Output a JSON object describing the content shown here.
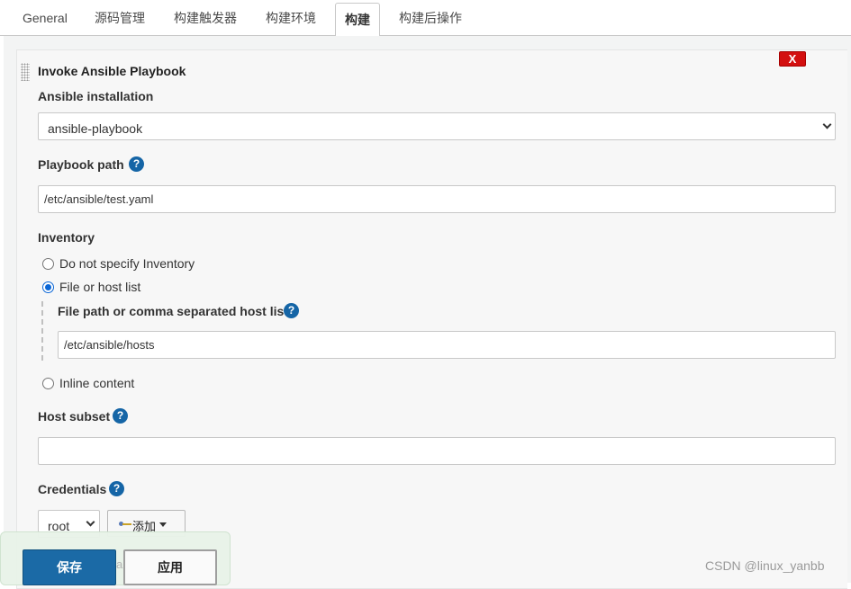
{
  "tabs": [
    {
      "label": "General",
      "active": false
    },
    {
      "label": "源码管理",
      "active": false
    },
    {
      "label": "构建触发器",
      "active": false
    },
    {
      "label": "构建环境",
      "active": false
    },
    {
      "label": "构建",
      "active": true
    },
    {
      "label": "构建后操作",
      "active": false
    }
  ],
  "step": {
    "title": "Invoke Ansible Playbook",
    "delete_label": "X",
    "ansible_installation": {
      "label": "Ansible installation",
      "value": "ansible-playbook"
    },
    "playbook_path": {
      "label": "Playbook path",
      "help": "?",
      "value": "/etc/ansible/test.yaml"
    },
    "inventory": {
      "label": "Inventory",
      "options": [
        {
          "label": "Do not specify Inventory",
          "checked": false
        },
        {
          "label": "File or host list",
          "checked": true
        },
        {
          "label": "Inline content",
          "checked": false
        }
      ],
      "file_path": {
        "label": "File path or comma separated host list",
        "help": "?",
        "value": "/etc/ansible/hosts"
      }
    },
    "host_subset": {
      "label": "Host subset",
      "help": "?",
      "value": ""
    },
    "credentials": {
      "label": "Credentials",
      "help": "?",
      "selected": "root",
      "add_label": "添加"
    }
  },
  "bottom": {
    "save_label": "保存",
    "apply_label": "应用",
    "ghost_text": "a"
  },
  "watermark": "CSDN @linux_yanbb",
  "colors": {
    "primary": "#1b6aa6",
    "delete": "#d30f0f",
    "help": "#1565a6",
    "radio_checked": "#0a66d6"
  }
}
